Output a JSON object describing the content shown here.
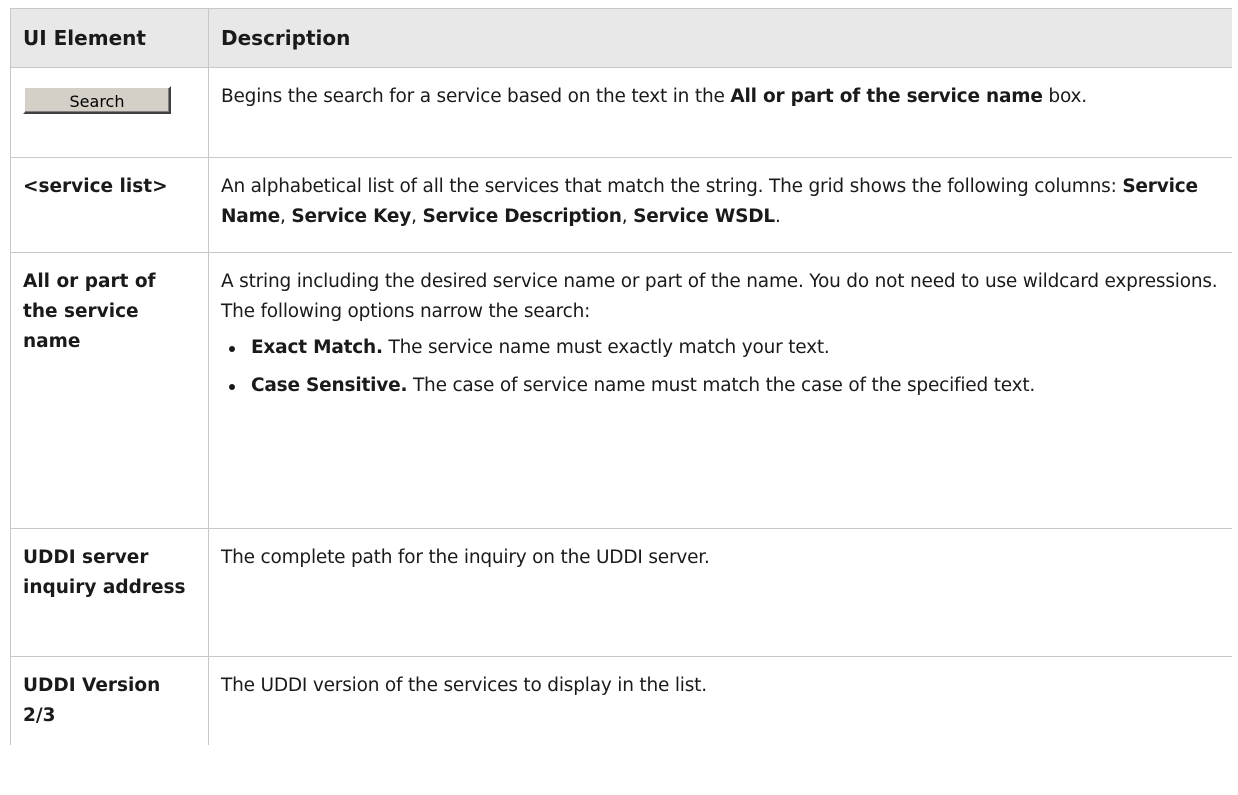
{
  "header": {
    "col_element": "UI Element",
    "col_description": "Description"
  },
  "rows": [
    {
      "element_button": "Search",
      "desc_a": "Begins the search for a service based on the text in the ",
      "desc_b": "All or part of the service name",
      "desc_c": " box."
    },
    {
      "element": "<service list>",
      "desc_a": "An alphabetical list of all the services that match the string. The grid shows the following columns: ",
      "col1": "Service Name",
      "col2": "Service Key",
      "col3": "Service Description",
      "col4": "Service WSDL",
      "sep": ", ",
      "end": "."
    },
    {
      "element": "All or part of the service name",
      "desc_line1": "A string including the desired service name or part of the name. You do not need to use wildcard expressions.",
      "desc_line2": "The following options narrow the search:",
      "options": [
        {
          "label": "Exact Match.",
          "text": " The service name must exactly match your text."
        },
        {
          "label": "Case Sensitive.",
          "text": " The case of service name must match the case of the specified text."
        }
      ]
    },
    {
      "element": "UDDI server inquiry address",
      "desc": "The complete path for the inquiry on the UDDI server."
    },
    {
      "element": "UDDI Version 2/3",
      "desc": "The UDDI version of the services to display in the list."
    }
  ]
}
